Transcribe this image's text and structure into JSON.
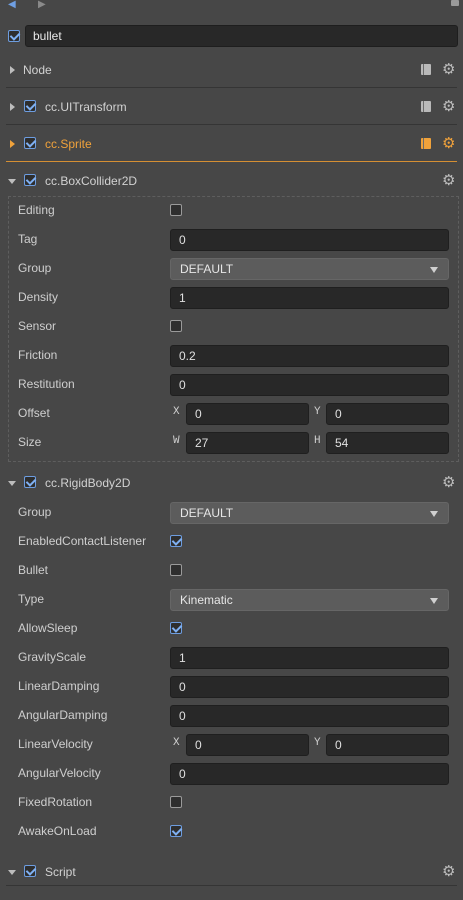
{
  "window": {
    "nav_back": "◀",
    "nav_forward": "▶"
  },
  "node": {
    "name": "bullet",
    "active": true
  },
  "icons": {
    "gear": "gear-icon",
    "book": "book-icon"
  },
  "colors": {
    "accent": "#f0a23b",
    "check": "#7fb0f2",
    "bg": "#474747"
  },
  "components": {
    "node": {
      "title": "Node"
    },
    "uitransform": {
      "title": "cc.UITransform"
    },
    "sprite": {
      "title": "cc.Sprite"
    },
    "boxcollider": {
      "title": "cc.BoxCollider2D",
      "editing": {
        "label": "Editing",
        "checked": false
      },
      "tag": {
        "label": "Tag",
        "value": "0"
      },
      "group": {
        "label": "Group",
        "value": "DEFAULT"
      },
      "density": {
        "label": "Density",
        "value": "1"
      },
      "sensor": {
        "label": "Sensor",
        "checked": false
      },
      "friction": {
        "label": "Friction",
        "value": "0.2"
      },
      "restitution": {
        "label": "Restitution",
        "value": "0"
      },
      "offset": {
        "label": "Offset",
        "x_label": "X",
        "x": "0",
        "y_label": "Y",
        "y": "0"
      },
      "size": {
        "label": "Size",
        "w_label": "W",
        "w": "27",
        "h_label": "H",
        "h": "54"
      }
    },
    "rigidbody": {
      "title": "cc.RigidBody2D",
      "group": {
        "label": "Group",
        "value": "DEFAULT"
      },
      "enabled_contact_listener": {
        "label": "EnabledContactListener",
        "checked": true
      },
      "bullet": {
        "label": "Bullet",
        "checked": false
      },
      "type": {
        "label": "Type",
        "value": "Kinematic"
      },
      "allow_sleep": {
        "label": "AllowSleep",
        "checked": true
      },
      "gravity_scale": {
        "label": "GravityScale",
        "value": "1"
      },
      "linear_damping": {
        "label": "LinearDamping",
        "value": "0"
      },
      "angular_damping": {
        "label": "AngularDamping",
        "value": "0"
      },
      "linear_velocity": {
        "label": "LinearVelocity",
        "x_label": "X",
        "x": "0",
        "y_label": "Y",
        "y": "0"
      },
      "angular_velocity": {
        "label": "AngularVelocity",
        "value": "0"
      },
      "fixed_rotation": {
        "label": "FixedRotation",
        "checked": false
      },
      "awake_on_load": {
        "label": "AwakeOnLoad",
        "checked": true
      }
    },
    "script": {
      "title": "Script"
    }
  }
}
